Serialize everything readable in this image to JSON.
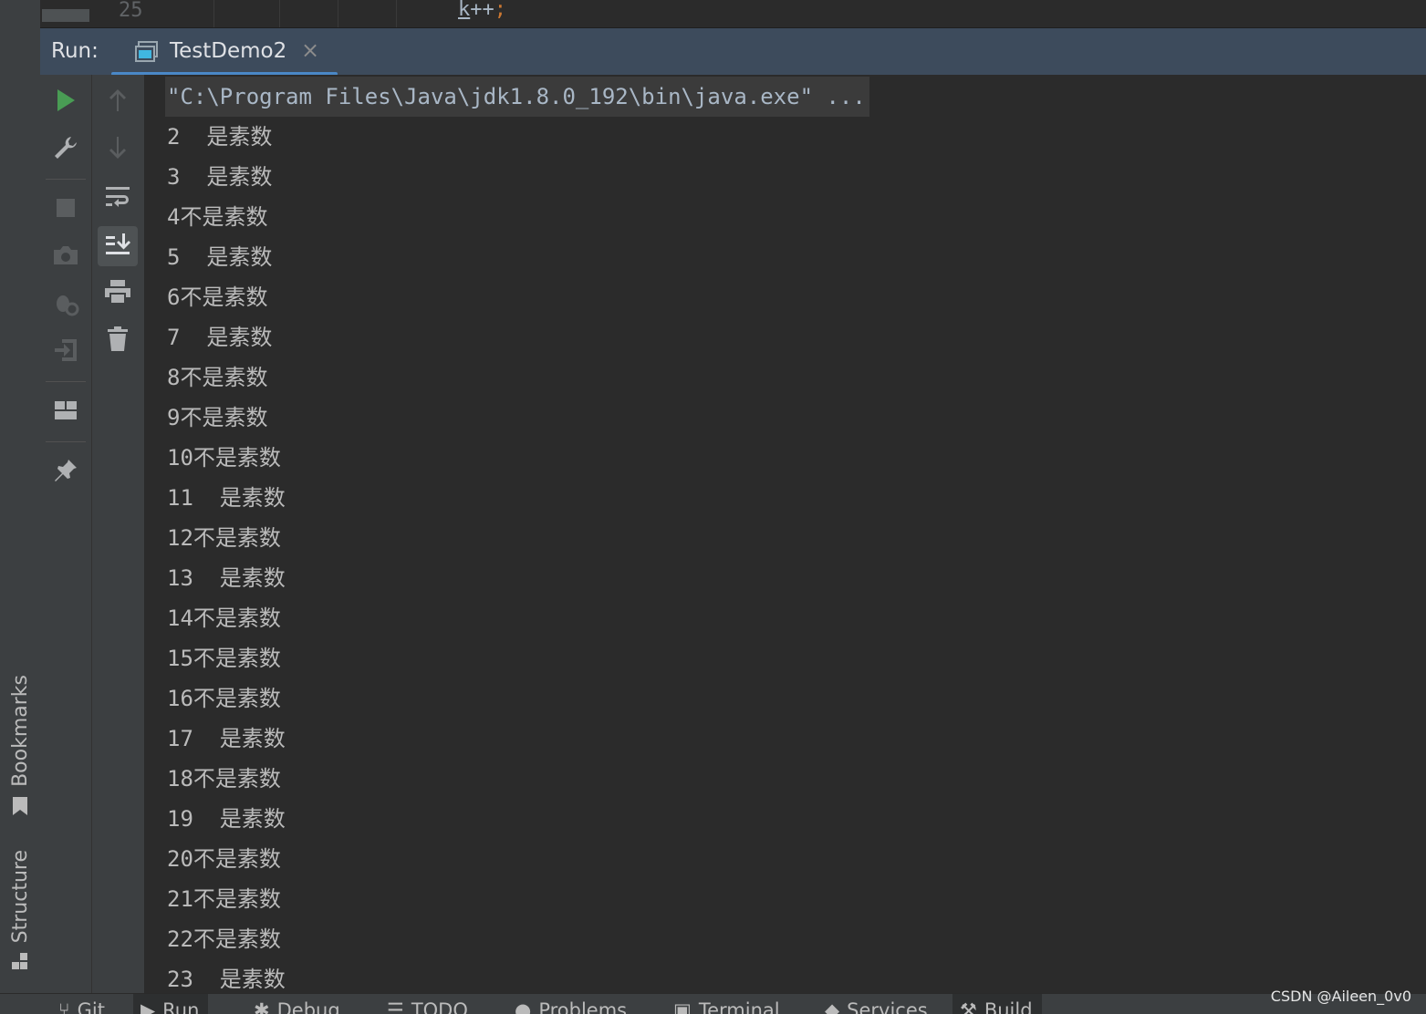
{
  "editor": {
    "line_number": "25",
    "code_ident": "k",
    "code_rest": "++",
    "code_semi": ";"
  },
  "run_window": {
    "label": "Run:",
    "tab_title": "TestDemo2",
    "tab_close": "×"
  },
  "left_strip": {
    "bookmarks": "Bookmarks",
    "structure": "Structure"
  },
  "console": {
    "command": "\"C:\\Program Files\\Java\\jdk1.8.0_192\\bin\\java.exe\" ...",
    "lines": [
      "2  是素数",
      "3  是素数",
      "4不是素数",
      "5  是素数",
      "6不是素数",
      "7  是素数",
      "8不是素数",
      "9不是素数",
      "10不是素数",
      "11  是素数",
      "12不是素数",
      "13  是素数",
      "14不是素数",
      "15不是素数",
      "16不是素数",
      "17  是素数",
      "18不是素数",
      "19  是素数",
      "20不是素数",
      "21不是素数",
      "22不是素数",
      "23  是素数"
    ]
  },
  "bottom_tabs": [
    {
      "label": "Git",
      "icon": "git-branch-icon"
    },
    {
      "label": "Run",
      "icon": "play-icon"
    },
    {
      "label": "Debug",
      "icon": "bug-icon"
    },
    {
      "label": "TODO",
      "icon": "list-icon"
    },
    {
      "label": "Problems",
      "icon": "problems-icon"
    },
    {
      "label": "Terminal",
      "icon": "terminal-icon"
    },
    {
      "label": "Services",
      "icon": "services-icon"
    },
    {
      "label": "Build",
      "icon": "hammer-icon"
    }
  ],
  "watermark": "CSDN @Aileen_0v0",
  "colors": {
    "accent": "#4a88c7",
    "run_green": "#499c54",
    "panel_header": "#3d4b5c",
    "background": "#2b2b2b"
  }
}
